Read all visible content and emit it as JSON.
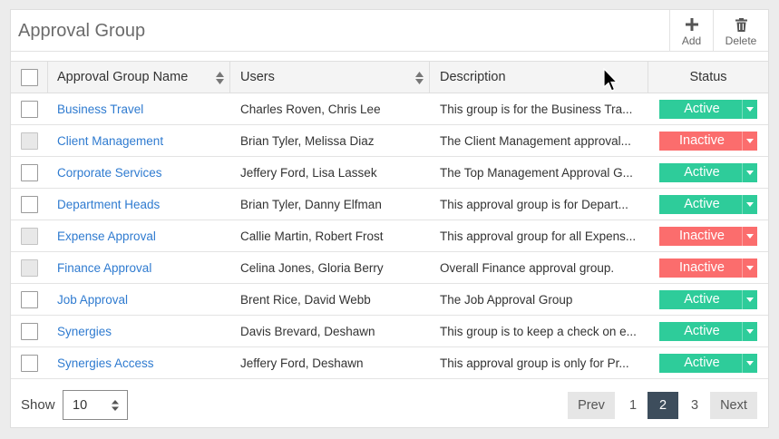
{
  "header": {
    "title": "Approval Group",
    "add_label": "Add",
    "delete_label": "Delete"
  },
  "columns": {
    "name": "Approval Group Name",
    "users": "Users",
    "description": "Description",
    "status": "Status"
  },
  "rows": [
    {
      "name": "Business Travel",
      "users": "Charles Roven, Chris Lee",
      "description": "This group is for the Business Tra...",
      "status": "Active",
      "checkbox_dim": false
    },
    {
      "name": "Client Management",
      "users": "Brian Tyler, Melissa Diaz",
      "description": "The Client Management approval...",
      "status": "Inactive",
      "checkbox_dim": true
    },
    {
      "name": "Corporate Services",
      "users": "Jeffery Ford, Lisa Lassek",
      "description": "The Top Management Approval G...",
      "status": "Active",
      "checkbox_dim": false
    },
    {
      "name": "Department Heads",
      "users": "Brian Tyler, Danny Elfman",
      "description": "This approval group is for Depart...",
      "status": "Active",
      "checkbox_dim": false
    },
    {
      "name": "Expense Approval",
      "users": "Callie Martin, Robert Frost",
      "description": "This approval group for all Expens...",
      "status": "Inactive",
      "checkbox_dim": true
    },
    {
      "name": "Finance Approval",
      "users": "Celina Jones, Gloria Berry",
      "description": "Overall Finance approval group.",
      "status": "Inactive",
      "checkbox_dim": true
    },
    {
      "name": "Job Approval",
      "users": "Brent Rice, David Webb",
      "description": "The Job Approval Group",
      "status": "Active",
      "checkbox_dim": false
    },
    {
      "name": "Synergies",
      "users": "Davis Brevard, Deshawn",
      "description": "This group is to keep a check on e...",
      "status": "Active",
      "checkbox_dim": false
    },
    {
      "name": "Synergies Access",
      "users": "Jeffery Ford, Deshawn",
      "description": "This approval group is only for Pr...",
      "status": "Active",
      "checkbox_dim": false
    }
  ],
  "status_colors": {
    "Active": "#2ecc9a",
    "Inactive": "#fb6d6d"
  },
  "footer": {
    "show_label": "Show",
    "page_size": "10",
    "prev_label": "Prev",
    "next_label": "Next",
    "pages": [
      "1",
      "2",
      "3"
    ],
    "current_page": "2"
  },
  "icons": {
    "add": "plus-icon",
    "delete": "trash-icon",
    "sort": "sort-icon",
    "cursor": "mouse-pointer-icon"
  }
}
